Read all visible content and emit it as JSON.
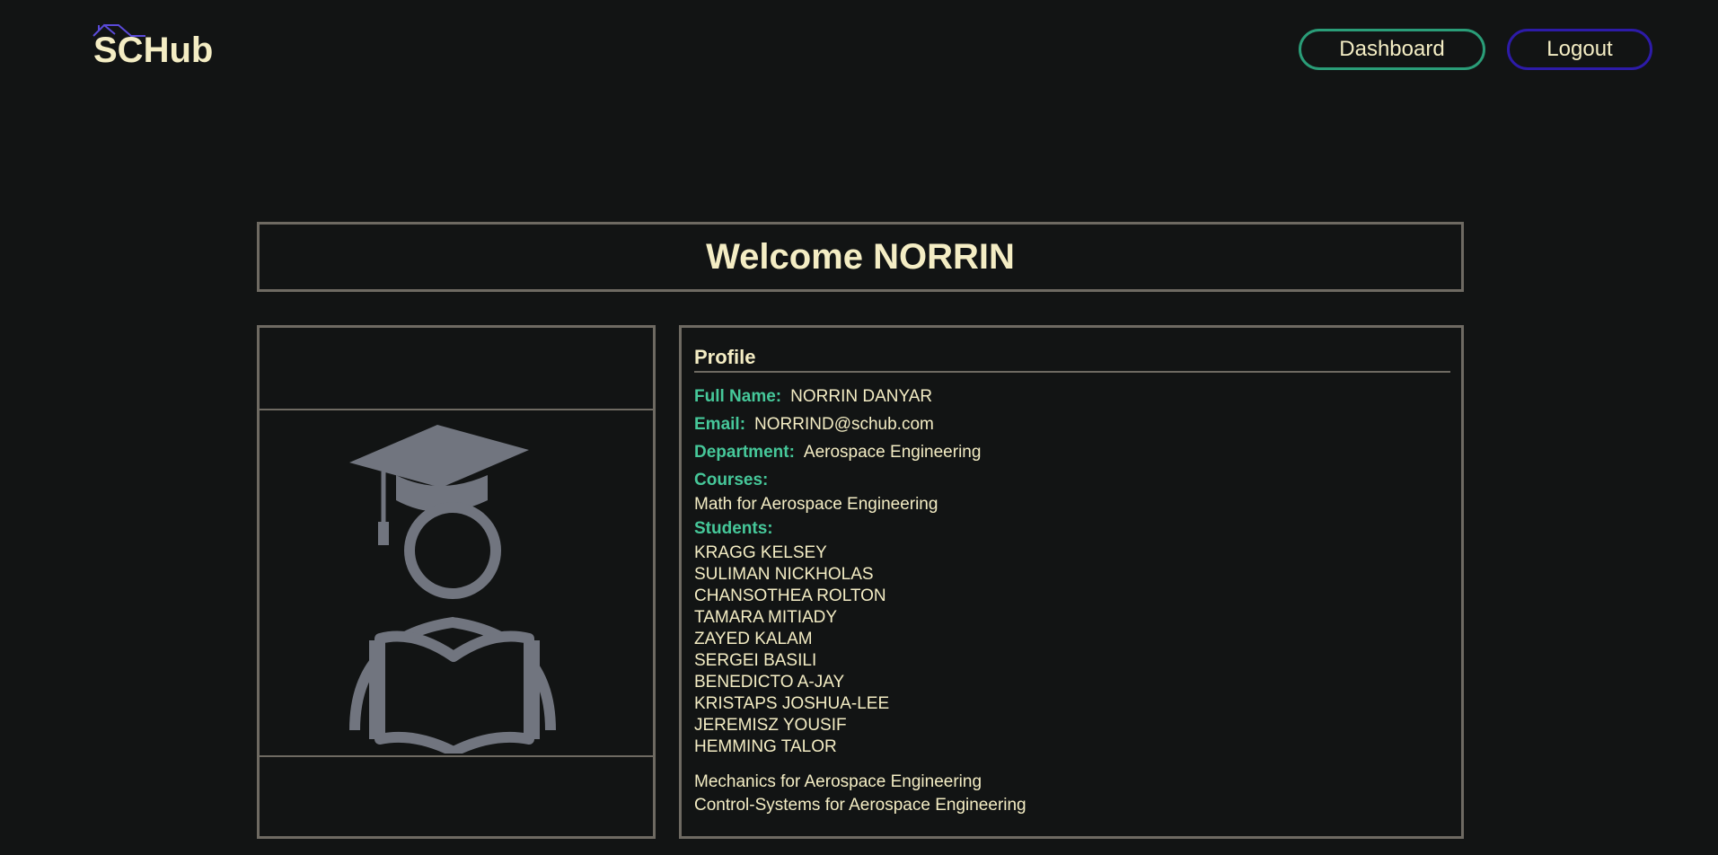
{
  "header": {
    "logo_text": "SCHub",
    "dashboard_label": "Dashboard",
    "logout_label": "Logout"
  },
  "welcome": {
    "title": "Welcome NORRIN"
  },
  "avatar": {
    "icon": "graduate-reading-icon"
  },
  "profile": {
    "title": "Profile",
    "full_name_label": "Full Name:",
    "full_name": "NORRIN DANYAR",
    "email_label": "Email:",
    "email": "NORRIND@schub.com",
    "department_label": "Department:",
    "department": "Aerospace Engineering",
    "courses_label": "Courses:",
    "courses": [
      "Math for Aerospace Engineering",
      "Mechanics for Aerospace Engineering",
      "Control-Systems for Aerospace Engineering"
    ],
    "students_label": "Students:",
    "students": [
      "KRAGG KELSEY",
      "SULIMAN NICKHOLAS",
      "CHANSOTHEA ROLTON",
      "TAMARA MITIADY",
      "ZAYED KALAM",
      "SERGEI BASILI",
      "BENEDICTO A-JAY",
      "KRISTAPS JOSHUA-LEE",
      "JEREMISZ YOUSIF",
      "HEMMING TALOR"
    ]
  },
  "colors": {
    "background": "#121414",
    "text": "#f4edc4",
    "label": "#46c89a",
    "border": "#6e6a62",
    "dashboard_border": "#2a9d78",
    "logout_border": "#2d1ba8",
    "logo_roof": "#5a4ad8",
    "icon": "#71757f"
  }
}
